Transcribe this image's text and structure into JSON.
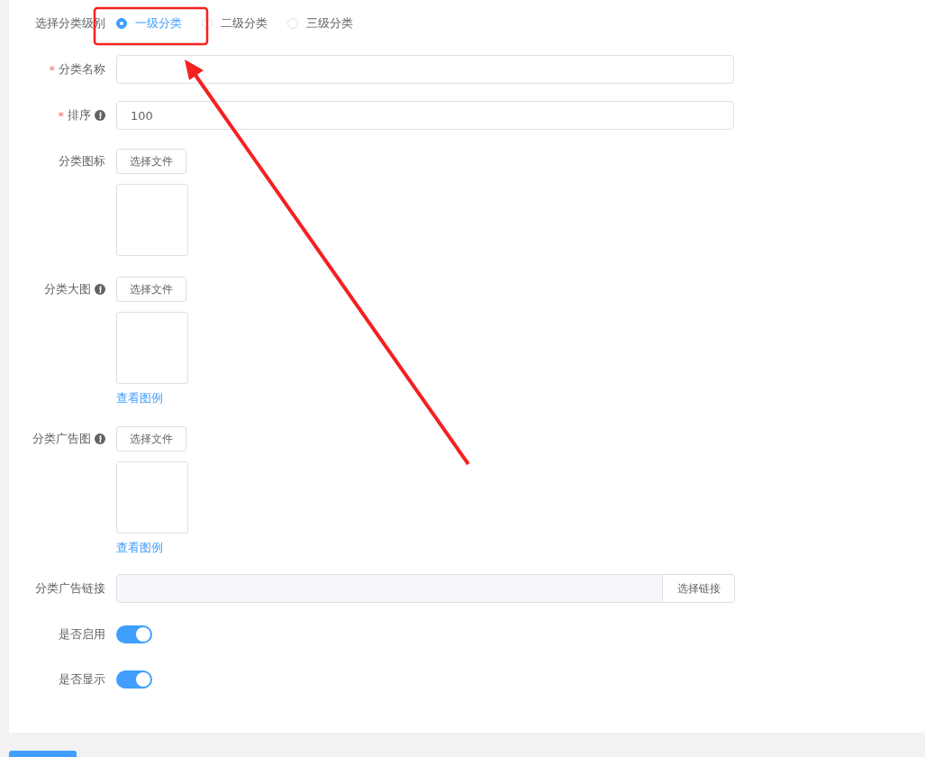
{
  "form": {
    "rows": [
      {
        "kind": "radio",
        "label": "选择分类级别",
        "info": false,
        "options": [
          {
            "label": "一级分类",
            "selected": true
          },
          {
            "label": "二级分类",
            "selected": false
          },
          {
            "label": "三级分类",
            "selected": false
          }
        ]
      },
      {
        "kind": "text",
        "label": "分类名称",
        "required_mark": "*",
        "info": false,
        "value": ""
      },
      {
        "kind": "text",
        "label": "排序",
        "required_mark": "*",
        "info": true,
        "value": "100"
      },
      {
        "kind": "upload",
        "label": "分类图标",
        "info": false,
        "button": "选择文件"
      },
      {
        "kind": "upload",
        "label": "分类大图",
        "info": true,
        "button": "选择文件",
        "link": "查看图例"
      },
      {
        "kind": "upload",
        "label": "分类广告图",
        "info": true,
        "button": "选择文件",
        "link": "查看图例"
      },
      {
        "kind": "link",
        "label": "分类广告链接",
        "info": false,
        "button": "选择链接"
      },
      {
        "kind": "switch",
        "label": "是否启用",
        "info": false,
        "on": true
      },
      {
        "kind": "switch",
        "label": "是否显示",
        "info": false,
        "on": true
      }
    ]
  }
}
